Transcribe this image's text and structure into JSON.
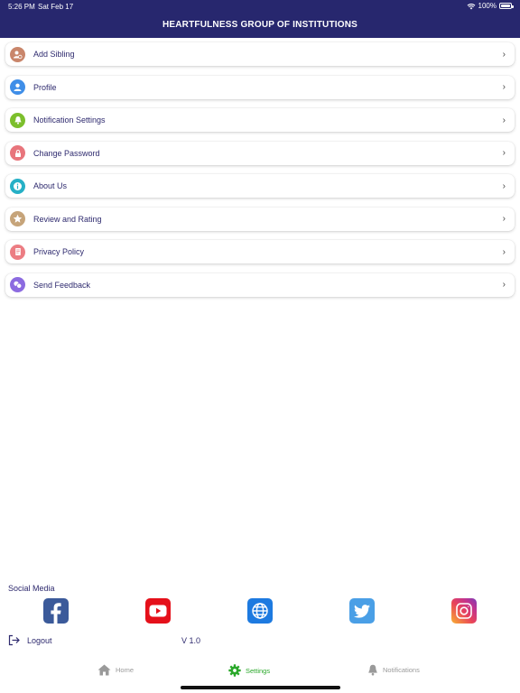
{
  "status": {
    "time": "5:26 PM",
    "date": "Sat Feb 17",
    "battery": "100%"
  },
  "header": {
    "title": "HEARTFULNESS GROUP OF INSTITUTIONS"
  },
  "menu": [
    {
      "label": "Add Sibling",
      "icon": "add-user-icon",
      "color": "#c9866b"
    },
    {
      "label": "Profile",
      "icon": "person-icon",
      "color": "#3f8ee8"
    },
    {
      "label": "Notification Settings",
      "icon": "bell-icon",
      "color": "#7cbf2c"
    },
    {
      "label": "Change Password",
      "icon": "lock-icon",
      "color": "#e8757c"
    },
    {
      "label": "About Us",
      "icon": "info-icon",
      "color": "#26b0c6"
    },
    {
      "label": "Review and Rating",
      "icon": "star-icon",
      "color": "#c6a47a"
    },
    {
      "label": "Privacy Policy",
      "icon": "document-icon",
      "color": "#ec7d83"
    },
    {
      "label": "Send Feedback",
      "icon": "feedback-icon",
      "color": "#8c6be0"
    }
  ],
  "social": {
    "title": "Social Media",
    "items": [
      {
        "name": "facebook-icon",
        "color": "#3b5a9a"
      },
      {
        "name": "youtube-icon",
        "color": "#e5101a"
      },
      {
        "name": "globe-icon",
        "color": "#1d7ae0"
      },
      {
        "name": "twitter-icon",
        "color": "#4a9fe6"
      },
      {
        "name": "instagram-icon",
        "color": "#d9317a"
      }
    ]
  },
  "footer": {
    "logout": "Logout",
    "version": "V 1.0"
  },
  "tabs": [
    {
      "label": "Home",
      "icon": "home-icon",
      "active": false
    },
    {
      "label": "Settings",
      "icon": "gear-icon",
      "active": true
    },
    {
      "label": "Notifications",
      "icon": "bell-icon",
      "active": false
    }
  ],
  "colors": {
    "header_bg": "#27276e",
    "text": "#2e2a6e",
    "active_tab": "#2aa82a",
    "inactive_tab": "#9a9a9a"
  }
}
